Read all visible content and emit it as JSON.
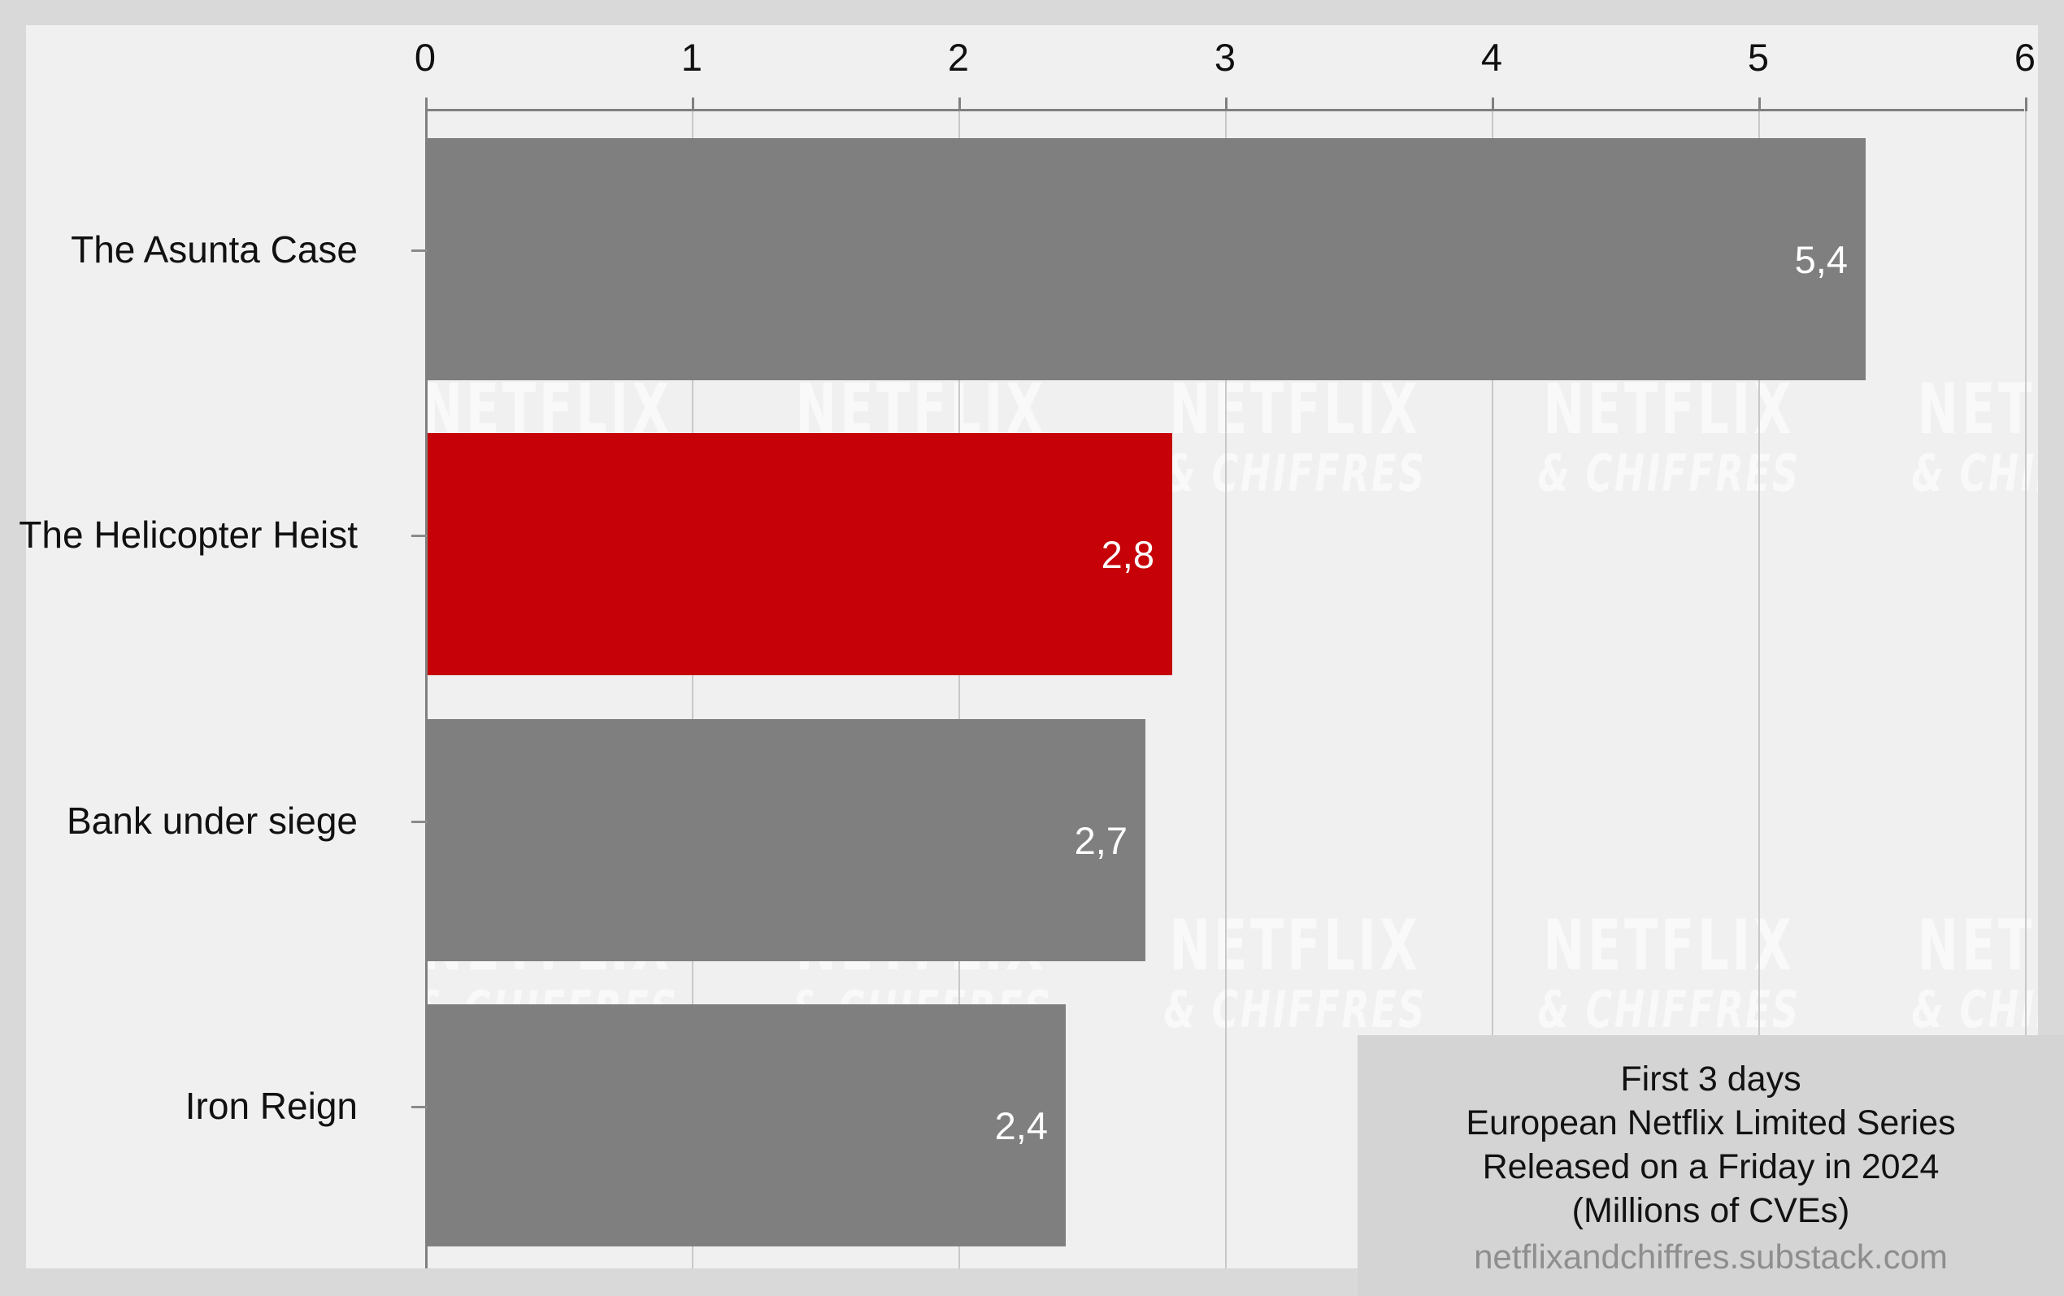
{
  "chart_data": {
    "type": "bar",
    "orientation": "horizontal",
    "title": "",
    "subtitle": "",
    "xlabel": "",
    "ylabel": "",
    "xlim": [
      0,
      6
    ],
    "ylim": null,
    "grid": true,
    "legend": null,
    "xticks": [
      "0",
      "1",
      "2",
      "3",
      "4",
      "5",
      "6"
    ],
    "xtick_values": [
      0,
      1,
      2,
      3,
      4,
      5,
      6
    ],
    "categories": [
      "The Asunta Case",
      "The Helicopter Heist",
      "Bank under siege",
      "Iron Reign"
    ],
    "values": [
      5.4,
      2.8,
      2.7,
      2.4
    ],
    "value_labels": [
      "5,4",
      "2,8",
      "2,7",
      "2,4"
    ],
    "bar_colors": [
      "#7f7f7f",
      "#c60208",
      "#7f7f7f",
      "#7f7f7f"
    ],
    "highlight_category": "The Helicopter Heist",
    "highlight_color": "#c60208",
    "default_bar_color": "#7f7f7f",
    "units": "Millions of CVEs",
    "annotations": {
      "caption_lines": [
        "First 3 days",
        "European Netflix Limited Series",
        "Released on a Friday in 2024",
        "(Millions of CVEs)"
      ],
      "source": "netflixandchiffres.substack.com",
      "watermark_top": "NETFLIX",
      "watermark_bottom": "& CHIFFRES"
    }
  },
  "colors": {
    "page_background": "#d9d9d9",
    "figure_background": "#f0f0f0",
    "caption_background": "#d4d4d4",
    "axis": "#808080",
    "gridline": "#c9c9c9",
    "tick_label": "#101010",
    "value_label": "#ffffff",
    "source_text": "#8e8e8e"
  }
}
